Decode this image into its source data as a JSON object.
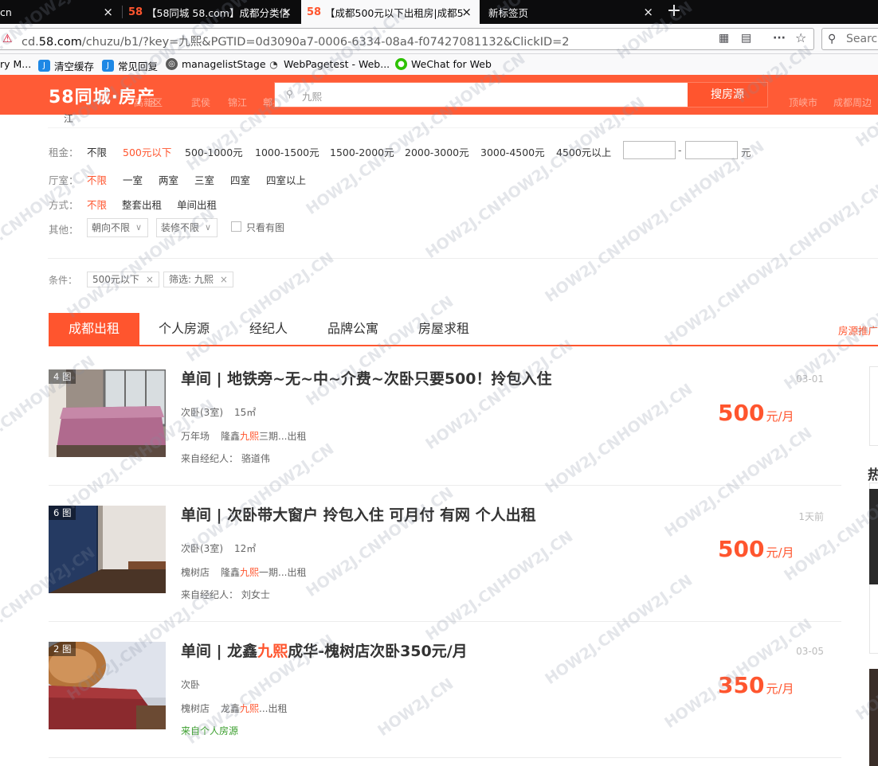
{
  "browser": {
    "tabs": [
      {
        "title": "cn",
        "close": "×"
      },
      {
        "title": "【58同城 58.com】成都分类信",
        "close": "×"
      },
      {
        "title": "【成都500元以下出租房|成都5",
        "close": "×"
      },
      {
        "title": "新标签页",
        "close": "×"
      }
    ],
    "tab_favicon": "58",
    "new_tab": "+",
    "url_prefix": "cd.",
    "url_domain": "58.com",
    "url_path": "/chuzu/b1/?key=九熙&PGTID=0d3090a7-0006-6334-08a4-f07427081132&ClickID=2",
    "search_placeholder": "Search",
    "bookmarks": [
      {
        "label": "ry M...",
        "icon": ""
      },
      {
        "label": "清空缓存",
        "icon": "J"
      },
      {
        "label": "常见回复",
        "icon": "J"
      },
      {
        "label": "managelistStage",
        "icon": "globe-icon"
      },
      {
        "label": "WebPagetest - Web...",
        "icon": "gauge-icon"
      },
      {
        "label": "WeChat for Web",
        "icon": "wechat-icon"
      }
    ]
  },
  "site": {
    "logo": "58同城·房产",
    "ghost_nav": [
      "区",
      "高新区",
      "武侯",
      "锦江",
      "郫县",
      "顶峡市",
      "成都周边"
    ],
    "search_value": "九熙",
    "search_button": "搜房源",
    "stub_text": "江"
  },
  "filters": {
    "rent": {
      "label": "租金：",
      "items": [
        "不限",
        "500元以下",
        "500-1000元",
        "1000-1500元",
        "1500-2000元",
        "2000-3000元",
        "3000-4500元",
        "4500元以上"
      ],
      "selected": "500元以下",
      "range_dash": "-",
      "unit": "元"
    },
    "rooms": {
      "label": "厅室：",
      "items": [
        "不限",
        "一室",
        "两室",
        "三室",
        "四室",
        "四室以上"
      ],
      "selected": "不限"
    },
    "mode": {
      "label": "方式：",
      "items": [
        "不限",
        "整套出租",
        "单间出租"
      ],
      "selected": "不限"
    },
    "other": {
      "label": "其他：",
      "orientation": "朝向不限",
      "decoration": "装修不限",
      "only_pics": "只看有图"
    }
  },
  "conditions": {
    "label": "条件：",
    "chips": [
      {
        "text": "500元以下",
        "x": "×"
      },
      {
        "text": "筛选: 九熙",
        "x": "×"
      }
    ]
  },
  "list_tabs": {
    "items": [
      "成都出租",
      "个人房源",
      "经纪人",
      "品牌公寓",
      "房屋求租"
    ],
    "active": "成都出租",
    "right_link": "房源推广"
  },
  "listings": [
    {
      "photos": "4 图",
      "title_pre": "单间 | 地铁旁~无~中~介费~次卧只要500！拎包入住",
      "title_hl": "",
      "title_post": "",
      "room": "次卧(3室)",
      "area": "15㎡",
      "district": "万年场",
      "community_pre": "隆鑫",
      "community_hl": "九熙",
      "community_post": "三期...出租",
      "source": "来自经纪人：  骆道伟",
      "date": "03-01",
      "price": "500",
      "unit": "元/月"
    },
    {
      "photos": "6 图",
      "title_pre": "单间 | 次卧带大窗户 拎包入住 可月付 有网 个人出租",
      "title_hl": "",
      "title_post": "",
      "room": "次卧(3室)",
      "area": "12㎡",
      "district": "槐树店",
      "community_pre": "隆鑫",
      "community_hl": "九熙",
      "community_post": "一期...出租",
      "source": "来自经纪人：  刘女士",
      "date": "1天前",
      "price": "500",
      "unit": "元/月"
    },
    {
      "photos": "2 图",
      "title_pre": "单间 | 龙鑫",
      "title_hl": "九熙",
      "title_post": "成华-槐树店次卧350元/月",
      "room": "次卧",
      "area": "",
      "district": "槐树店",
      "community_pre": "龙鑫",
      "community_hl": "九熙",
      "community_post": "...出租",
      "source": "来自个人房源",
      "date": "03-05",
      "price": "350",
      "unit": "元/月"
    }
  ],
  "sidebar": {
    "heading": "热"
  },
  "watermark": "HOW2J.CN",
  "colors": {
    "accent": "#ff552e",
    "header": "#ff5b36",
    "green": "#3c9f2f"
  }
}
